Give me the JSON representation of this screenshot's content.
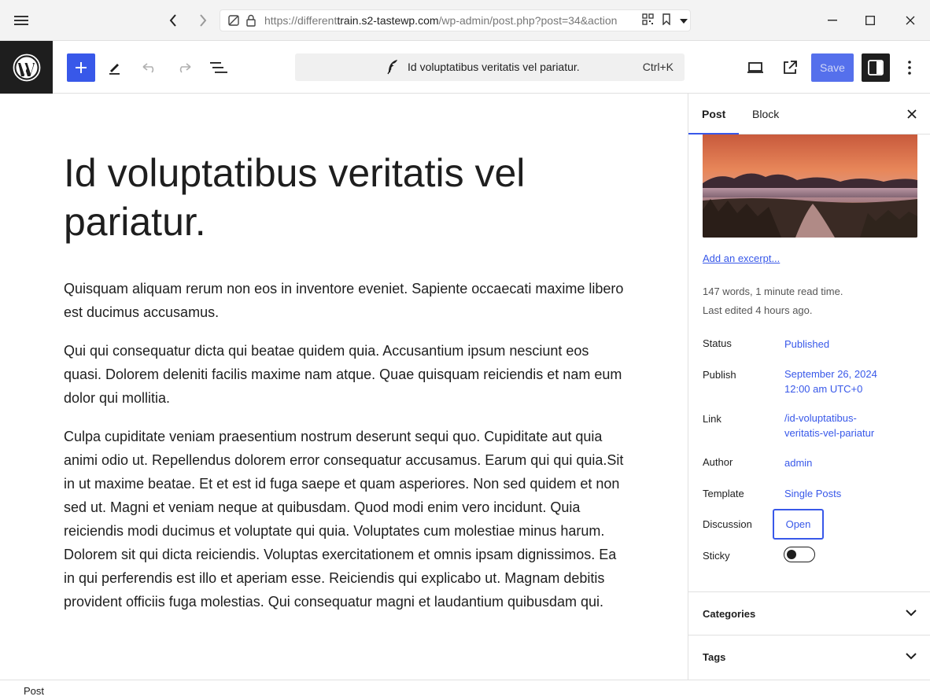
{
  "browser": {
    "url_prefix": "https://different",
    "url_domain": "train.s2-tastewp.com",
    "url_path": "/wp-admin/post.php?post=34&action"
  },
  "header": {
    "command_title": "Id voluptatibus veritatis vel pariatur.",
    "shortcut": "Ctrl+K",
    "save_label": "Save"
  },
  "post": {
    "title": "Id voluptatibus veritatis vel pariatur.",
    "paragraphs": [
      "Quisquam aliquam rerum non eos in inventore eveniet. Sapiente occaecati maxime libero est ducimus accusamus.",
      "Qui qui consequatur dicta qui beatae quidem quia. Accusantium ipsum nesciunt eos quasi. Dolorem deleniti facilis maxime nam atque. Quae quisquam reiciendis et nam eum dolor qui mollitia.",
      "Culpa cupiditate veniam praesentium nostrum deserunt sequi quo. Cupiditate aut quia animi odio ut. Repellendus dolorem error consequatur accusamus. Earum qui qui quia.Sit in ut maxime beatae. Et et est id fuga saepe et quam asperiores. Non sed quidem et non sed ut. Magni et veniam neque at quibusdam. Quod modi enim vero incidunt. Quia reiciendis modi ducimus et voluptate qui quia. Voluptates cum molestiae minus harum. Dolorem sit qui dicta reiciendis. Voluptas exercitationem et omnis ipsam dignissimos. Ea in qui perferendis est illo et aperiam esse. Reiciendis qui explicabo ut. Magnam debitis provident officiis fuga molestias. Qui consequatur magni et laudantium quibusdam qui."
    ]
  },
  "sidebar": {
    "tabs": [
      "Post",
      "Block"
    ],
    "excerpt_link": "Add an excerpt...",
    "word_count": "147 words, 1 minute read time.",
    "last_edited": "Last edited 4 hours ago.",
    "rows": {
      "status": {
        "label": "Status",
        "value": "Published"
      },
      "publish": {
        "label": "Publish",
        "value_line1": "September 26, 2024",
        "value_line2": "12:00 am UTC+0"
      },
      "link": {
        "label": "Link",
        "value_line1": "/id-voluptatibus-",
        "value_line2": "veritatis-vel-pariatur"
      },
      "author": {
        "label": "Author",
        "value": "admin"
      },
      "template": {
        "label": "Template",
        "value": "Single Posts"
      },
      "discussion": {
        "label": "Discussion",
        "value": "Open"
      },
      "sticky": {
        "label": "Sticky",
        "checked": false
      }
    },
    "panels": [
      "Categories",
      "Tags"
    ]
  },
  "footer": {
    "breadcrumb": "Post"
  },
  "colors": {
    "accent": "#3858e9",
    "dark": "#1e1e1e"
  }
}
